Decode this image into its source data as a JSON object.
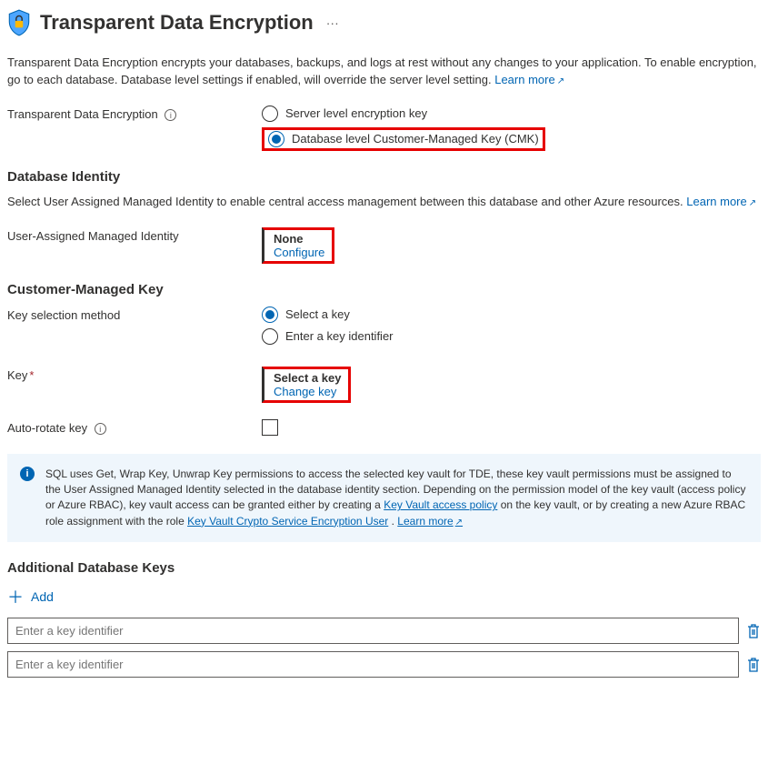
{
  "header": {
    "title": "Transparent Data Encryption"
  },
  "intro": {
    "text": "Transparent Data Encryption encrypts your databases, backups, and logs at rest without any changes to your application. To enable encryption, go to each database. Database level settings if enabled, will override the server level setting.",
    "learn_more": "Learn more"
  },
  "tde_field": {
    "label": "Transparent Data Encryption",
    "options": {
      "server": "Server level encryption key",
      "db_cmk": "Database level Customer-Managed Key (CMK)"
    }
  },
  "db_identity": {
    "heading": "Database Identity",
    "desc": "Select User Assigned Managed Identity to enable central access management between this database and other Azure resources.",
    "learn_more": "Learn more",
    "uami_label": "User-Assigned Managed Identity",
    "uami_value": "None",
    "configure": "Configure"
  },
  "cmk": {
    "heading": "Customer-Managed Key",
    "selection_label": "Key selection method",
    "options": {
      "select": "Select a key",
      "identifier": "Enter a key identifier"
    },
    "key_label": "Key",
    "key_value": "Select a key",
    "change_key": "Change key",
    "autorotate_label": "Auto-rotate key"
  },
  "banner": {
    "t1": "SQL uses Get, Wrap Key, Unwrap Key permissions to access the selected key vault for TDE, these key vault permissions must be assigned to the User Assigned Managed Identity selected in the database identity section. Depending on the permission model of the key vault (access policy or Azure RBAC), key vault access can be granted either by creating a ",
    "link1": "Key Vault access policy",
    "t2": " on the key vault, or by creating a new Azure RBAC role assignment with the role ",
    "link2": "Key Vault Crypto Service Encryption User",
    "t3": ". ",
    "learn_more": "Learn more"
  },
  "additional": {
    "heading": "Additional Database Keys",
    "add": "Add",
    "placeholder": "Enter a key identifier"
  }
}
